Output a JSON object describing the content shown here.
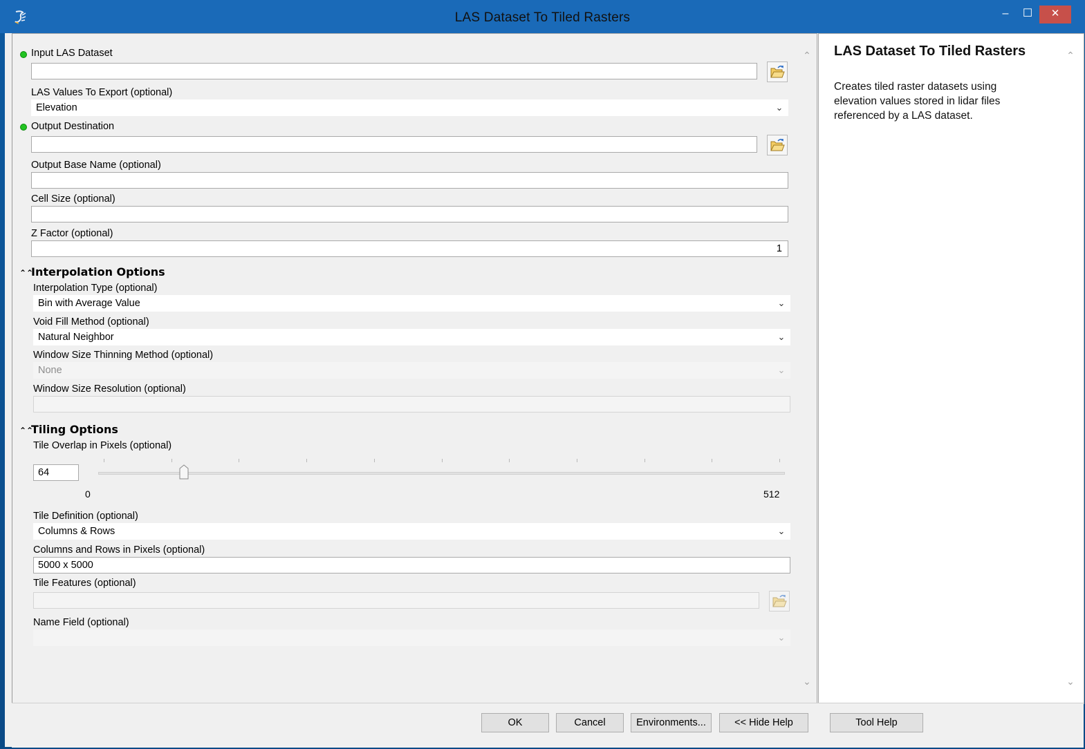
{
  "window": {
    "title": "LAS Dataset To Tiled Rasters",
    "minimize_glyph": "–",
    "maximize_glyph": "☐",
    "close_glyph": "✕",
    "close_color": "#c7504a",
    "titlebar_color": "#1a6ab8"
  },
  "params": {
    "input_las": {
      "label": "Input LAS Dataset",
      "value": "",
      "required": true
    },
    "las_values": {
      "label": "LAS Values To Export (optional)",
      "value": "Elevation"
    },
    "output_dest": {
      "label": "Output Destination",
      "value": "",
      "required": true
    },
    "output_base": {
      "label": "Output Base Name (optional)",
      "value": ""
    },
    "cell_size": {
      "label": "Cell Size (optional)",
      "value": ""
    },
    "z_factor": {
      "label": "Z Factor (optional)",
      "value": "1"
    }
  },
  "interpolation": {
    "heading": "Interpolation Options",
    "type": {
      "label": "Interpolation Type (optional)",
      "value": "Bin with Average Value"
    },
    "void_fill": {
      "label": "Void Fill Method (optional)",
      "value": "Natural Neighbor"
    },
    "thinning": {
      "label": "Window Size Thinning Method (optional)",
      "value": "None",
      "enabled": false
    },
    "resolution": {
      "label": "Window Size Resolution (optional)",
      "value": "",
      "enabled": false
    }
  },
  "tiling": {
    "heading": "Tiling Options",
    "overlap": {
      "label": "Tile Overlap in Pixels (optional)",
      "value": "64",
      "min_label": "0",
      "max_label": "512",
      "min": 0,
      "max": 512,
      "level": 64
    },
    "definition": {
      "label": "Tile Definition (optional)",
      "value": "Columns & Rows"
    },
    "cols_rows": {
      "label": "Columns and Rows in Pixels (optional)",
      "value": "5000 x 5000"
    },
    "features": {
      "label": "Tile Features (optional)",
      "value": "",
      "enabled": false
    },
    "name_field": {
      "label": "Name Field (optional)",
      "value": "",
      "enabled": false
    }
  },
  "buttons": {
    "ok": "OK",
    "cancel": "Cancel",
    "environments": "Environments...",
    "hide_help": "<< Hide Help",
    "tool_help": "Tool Help"
  },
  "help": {
    "title": "LAS Dataset To Tiled Rasters",
    "description": "Creates tiled raster datasets using elevation values stored in lidar files referenced by a LAS dataset."
  },
  "icons": {
    "app": "toolbox-script-icon",
    "browse": "open-folder-icon",
    "collapse": "double-chevron-up-icon",
    "dropdown": "chevron-down-icon"
  },
  "colors": {
    "required_dot": "#22c322",
    "panel_bg": "#f0f0f0"
  }
}
